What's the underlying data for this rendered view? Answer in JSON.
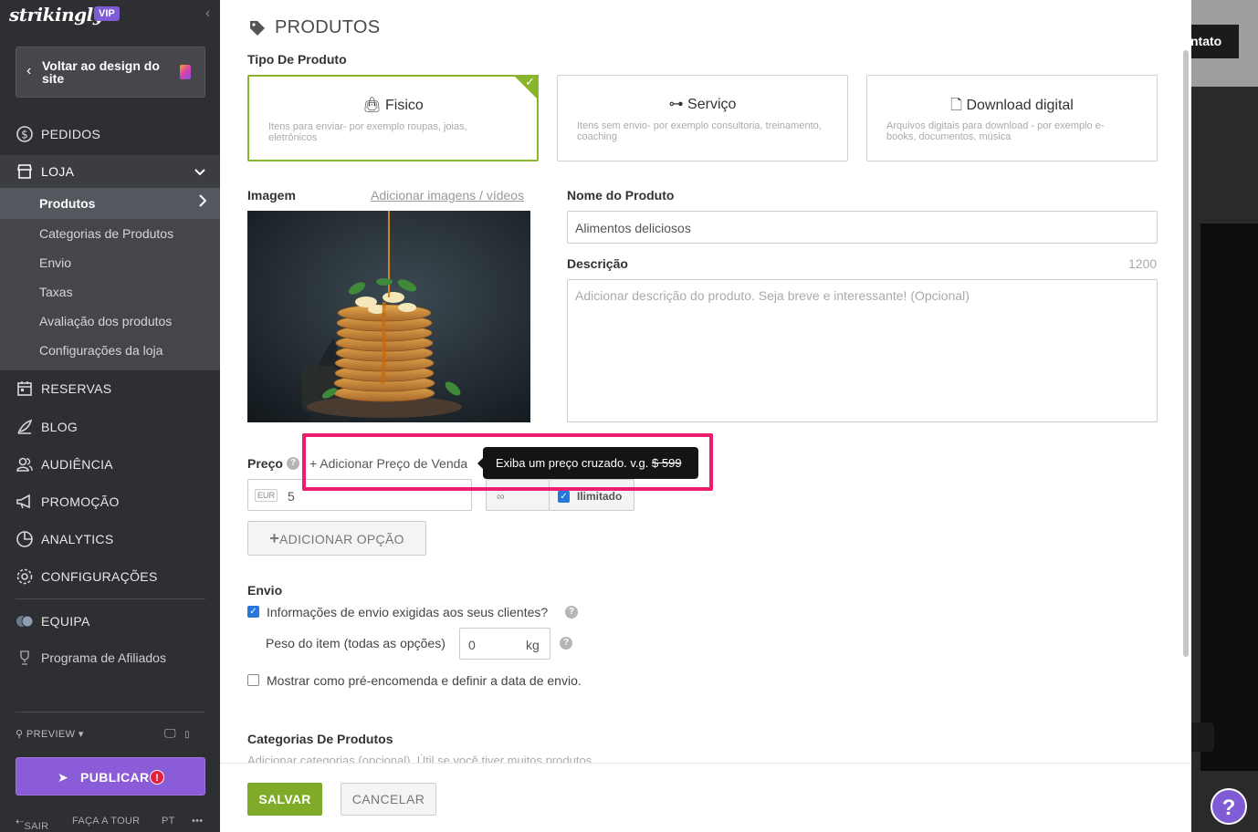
{
  "sidebar": {
    "brand": "strikingly",
    "vip": "VIP",
    "back_label": "Voltar ao design do site",
    "nav": {
      "pedidos": "PEDIDOS",
      "loja": "LOJA",
      "reservas": "RESERVAS",
      "blog": "BLOG",
      "audiencia": "AUDIÊNCIA",
      "promocao": "PROMOÇÃO",
      "analytics": "ANALYTICS",
      "configuracoes": "CONFIGURAÇÕES",
      "equipa": "EQUIPA",
      "afiliados": "Programa de Afiliados"
    },
    "submenu": {
      "produtos": "Produtos",
      "categorias": "Categorias de Produtos",
      "envio": "Envio",
      "taxas": "Taxas",
      "avaliacao": "Avaliação dos produtos",
      "configuracoes_loja": "Configurações da loja"
    },
    "preview": "PREVIEW",
    "publish": "PUBLICAR",
    "footer": {
      "sair": "SAIR",
      "tour": "FAÇA A TOUR",
      "lang": "PT",
      "more": "•••"
    }
  },
  "background": {
    "contato": "ntato"
  },
  "panel": {
    "title": "PRODUTOS",
    "tipo_label": "Tipo De Produto",
    "types": [
      {
        "title": "Fisico",
        "desc": "Itens para enviar- por exemplo roupas, joias, eletrônicos"
      },
      {
        "title": "Serviço",
        "desc": "Itens sem envio- por exemplo consultoria, treinamento, coaching"
      },
      {
        "title": "Download digital",
        "desc": "Arquivos digitais para download - por exemplo e-books, documentos, música"
      }
    ],
    "imagem_label": "Imagem",
    "add_images": "Adicionar imagens / vídeos",
    "nome_label": "Nome do Produto",
    "nome_value": "Alimentos deliciosos",
    "descricao_label": "Descrição",
    "descricao_count": "1200",
    "descricao_placeholder": "Adicionar descrição do produto. Seja breve e interessante! (Opcional)",
    "preco_label": "Preço",
    "add_sale_price": "+ Adicionar Preço de Venda",
    "tooltip_text": "Exiba um preço cruzado. v.g. ",
    "tooltip_strike": "$ 599",
    "currency": "EUR",
    "price_value": "5",
    "stock_value": "∞",
    "ilimitado": "Ilimitado",
    "add_option": "ADICIONAR OPÇÃO",
    "envio_label": "Envio",
    "envio_check": "Informações de envio exigidas aos seus clientes?",
    "peso_label": "Peso do item (todas as opções)",
    "peso_value": "0",
    "peso_unit": "kg",
    "preorder": "Mostrar como pré-encomenda e definir a data de envio.",
    "categorias_label": "Categorias De Produtos",
    "categorias_hint": "Adicionar categorias (opcional). Útil se você tiver muitos produtos."
  },
  "actions": {
    "save": "SALVAR",
    "cancel": "CANCELAR"
  },
  "help": "?"
}
